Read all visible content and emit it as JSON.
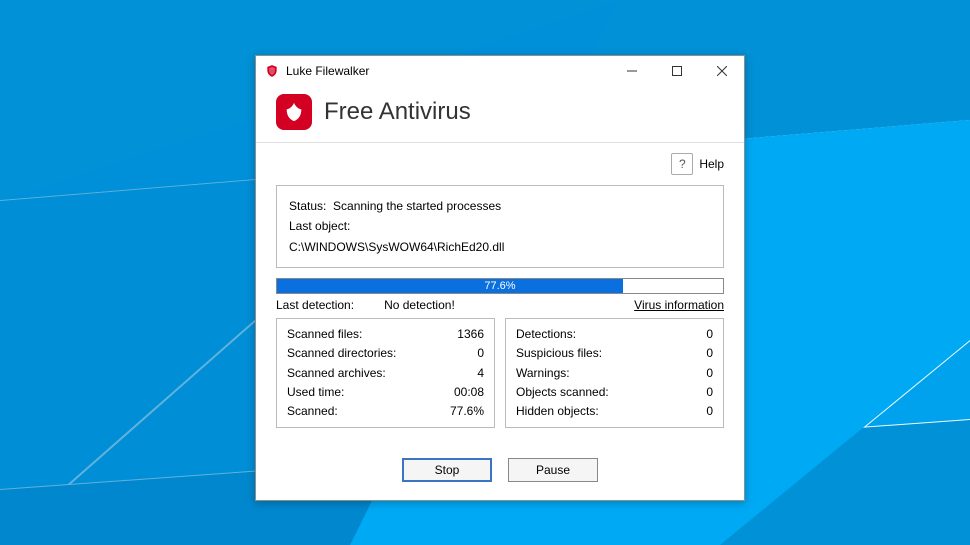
{
  "window": {
    "title": "Luke Filewalker"
  },
  "header": {
    "brand": "Free Antivirus"
  },
  "help": {
    "icon_label": "?",
    "label": "Help"
  },
  "status": {
    "status_label": "Status:",
    "status_value": "Scanning the started processes",
    "last_object_label": "Last object:",
    "last_object_value": "C:\\WINDOWS\\SysWOW64\\RichEd20.dll"
  },
  "progress": {
    "percent": 77.6,
    "label": "77.6%"
  },
  "detection": {
    "last_detection_label": "Last detection:",
    "last_detection_value": "No detection!",
    "virus_info_label": "Virus information"
  },
  "stats_left": [
    {
      "label": "Scanned files:",
      "value": "1366"
    },
    {
      "label": "Scanned directories:",
      "value": "0"
    },
    {
      "label": "Scanned archives:",
      "value": "4"
    },
    {
      "label": "Used time:",
      "value": "00:08"
    },
    {
      "label": "Scanned:",
      "value": "77.6%"
    }
  ],
  "stats_right": [
    {
      "label": "Detections:",
      "value": "0"
    },
    {
      "label": "Suspicious files:",
      "value": "0"
    },
    {
      "label": "Warnings:",
      "value": "0"
    },
    {
      "label": "Objects scanned:",
      "value": "0"
    },
    {
      "label": "Hidden objects:",
      "value": "0"
    }
  ],
  "buttons": {
    "stop": "Stop",
    "pause": "Pause"
  },
  "colors": {
    "brand_red": "#d40023",
    "progress_blue": "#0a6fdf",
    "desktop_blue": "#00a2ed"
  }
}
